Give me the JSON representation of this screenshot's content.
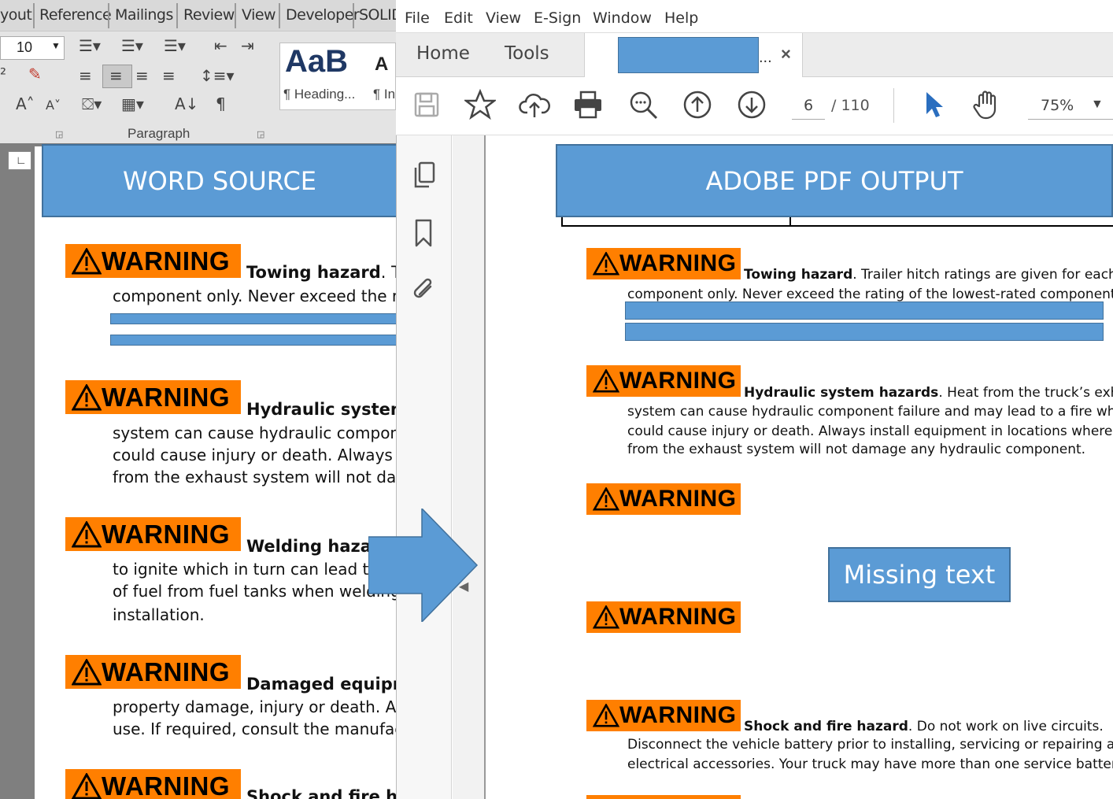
{
  "word": {
    "ribbon_tabs": [
      "yout",
      "Reference",
      "Mailings",
      "Review",
      "View",
      "Developer",
      "SOLID"
    ],
    "font_size": "10",
    "style_preview": "AaB",
    "style_name": "¶ Heading...",
    "style_name_2": "¶ In",
    "paragraph_group_label": "Paragraph",
    "label": "WORD SOURCE",
    "warnings": [
      {
        "badge": "WARNING",
        "title": "Towing hazard",
        "title_rest": ". Tra",
        "lines": [
          "component only.  Never exceed the ra"
        ]
      },
      {
        "badge": "WARNING",
        "title": "Hydraulic system h",
        "title_rest": "",
        "lines": [
          "system can cause hydraulic compone",
          "could cause injury or death. Always in",
          "from the exhaust system will not dam"
        ]
      },
      {
        "badge": "WARNING",
        "title": "Welding hazard",
        "title_rest": "",
        "lines": [
          "to ignite which in turn can lead to",
          "of fuel from fuel tanks when welding,",
          "installation."
        ]
      },
      {
        "badge": "WARNING",
        "title": "Damaged equipme",
        "title_rest": "",
        "lines": [
          "property damage, injury or death.  Alw",
          "use. If required, consult the manufact"
        ]
      },
      {
        "badge": "WARNING",
        "title": "Shock and fire haz",
        "title_rest": "",
        "lines": []
      }
    ]
  },
  "acrobat": {
    "menu": [
      "File",
      "Edit",
      "View",
      "E-Sign",
      "Window",
      "Help"
    ],
    "tabs": {
      "home": "Home",
      "tools": "Tools"
    },
    "doc_tab_ellipsis": "...",
    "doc_tab_close": "×",
    "page_current": "6",
    "page_total": "/  110",
    "zoom": "75%",
    "label": "ADOBE PDF OUTPUT",
    "missing_label": "Missing text",
    "warnings": [
      {
        "badge": "WARNING",
        "title": "Towing hazard",
        "title_rest": ". Trailer hitch ratings are given for each",
        "lines": [
          "component only.  Never exceed the rating of the lowest-rated component i"
        ]
      },
      {
        "badge": "WARNING",
        "title": "Hydraulic system hazards",
        "title_rest": ". Heat from the truck’s exhau",
        "lines": [
          "system can cause hydraulic component failure and may lead to a fire which",
          "could cause injury or death. Always install equipment in locations where he",
          "from the exhaust system will not damage any hydraulic component."
        ]
      },
      {
        "badge": "WARNING",
        "title": "",
        "title_rest": "",
        "lines": []
      },
      {
        "badge": "WARNING",
        "title": "",
        "title_rest": "",
        "lines": []
      },
      {
        "badge": "WARNING",
        "title": "Shock and fire hazard",
        "title_rest": ".  Do not work on live circuits.",
        "lines": [
          "Disconnect the vehicle battery prior to installing, servicing or repairing any",
          "electrical accessories. Your truck may have more than one service battery."
        ]
      }
    ]
  },
  "colors": {
    "warning_orange": "#ff7f00",
    "callout_blue": "#5b9bd5",
    "acrobat_blue": "#2a6ebf"
  }
}
